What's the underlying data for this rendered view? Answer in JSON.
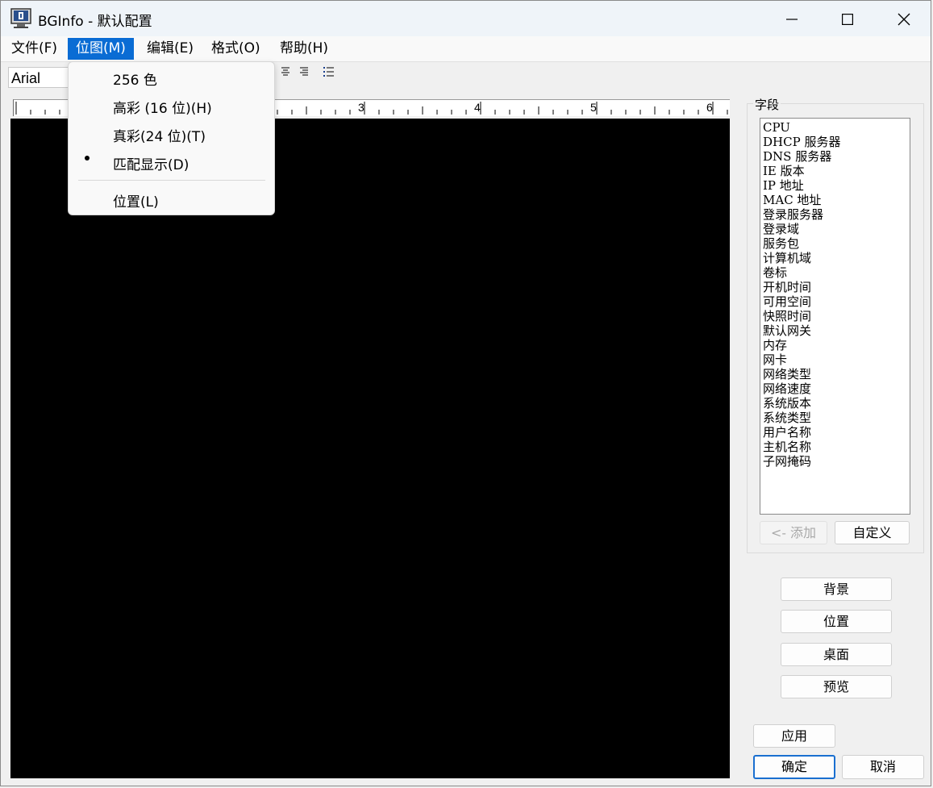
{
  "window": {
    "title": "BGInfo - 默认配置"
  },
  "menubar": {
    "items": [
      {
        "label": "文件(F)"
      },
      {
        "label": "位图(M)"
      },
      {
        "label": "编辑(E)"
      },
      {
        "label": "格式(O)"
      },
      {
        "label": "帮助(H)"
      }
    ]
  },
  "toolbar": {
    "font_name": "Arial"
  },
  "ruler": {
    "numbers": [
      "3",
      "4",
      "5",
      "6"
    ]
  },
  "bitmap_menu": {
    "items": [
      {
        "label": "256 色",
        "checked": false
      },
      {
        "label": "高彩 (16 位)(H)",
        "checked": false
      },
      {
        "label": "真彩(24 位)(T)",
        "checked": false
      },
      {
        "label": "匹配显示(D)",
        "checked": true
      },
      {
        "label": "位置(L)",
        "checked": false
      }
    ]
  },
  "fields_panel": {
    "label": "字段",
    "fields": [
      "CPU",
      "DHCP 服务器",
      "DNS 服务器",
      "IE 版本",
      "IP 地址",
      "MAC 地址",
      "登录服务器",
      "登录域",
      "服务包",
      "计算机域",
      "卷标",
      "开机时间",
      "可用空间",
      "快照时间",
      "默认网关",
      "内存",
      "网卡",
      "网络类型",
      "网络速度",
      "系统版本",
      "系统类型",
      "用户名称",
      "主机名称",
      "子网掩码"
    ],
    "add_label": "<- 添加",
    "custom_label": "自定义"
  },
  "side_buttons": {
    "background": "背景",
    "position": "位置",
    "desktop": "桌面",
    "preview": "预览"
  },
  "footer": {
    "apply": "应用",
    "ok": "确定",
    "cancel": "取消"
  },
  "colors": {
    "menu_highlight": "#0a6cd4",
    "canvas_background": "#000000",
    "title_bar": "#eff4f9"
  }
}
